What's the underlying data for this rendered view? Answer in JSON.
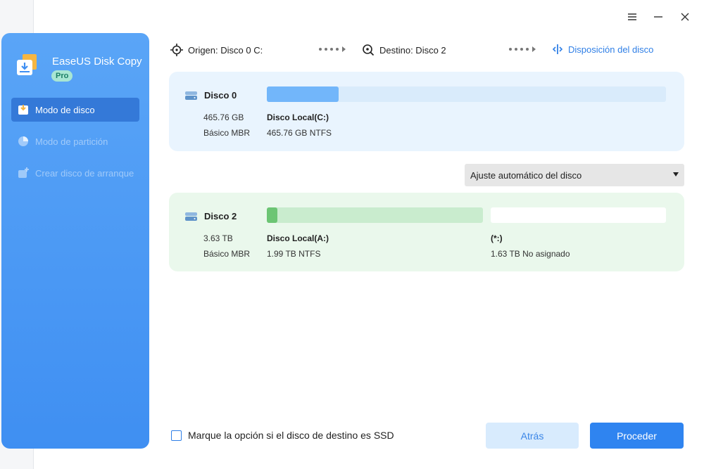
{
  "app": {
    "title": "EaseUS Disk Copy",
    "badge": "Pro"
  },
  "sidebar": {
    "items": [
      {
        "label": "Modo de disco",
        "active": true
      },
      {
        "label": "Modo de partición",
        "active": false
      },
      {
        "label": "Crear disco de arranque",
        "active": false
      }
    ]
  },
  "steps": {
    "source": "Origen: Disco 0 C:",
    "destination": "Destino: Disco 2",
    "layout": "Disposición del disco"
  },
  "source_disk": {
    "name": "Disco 0",
    "size": "465.76 GB",
    "type": "Básico MBR",
    "partition_name": "Disco Local(C:)",
    "partition_detail": "465.76 GB NTFS",
    "used_fraction": 0.18
  },
  "layout_select": {
    "value": "Ajuste automático del disco"
  },
  "dest_disk": {
    "name": "Disco 2",
    "size": "3.63 TB",
    "type": "Básico MBR",
    "partition_name": "Disco Local(A:)",
    "partition_detail": "1.99 TB NTFS",
    "partition_used_fraction": 0.05,
    "unallocated_name": "(*:)",
    "unallocated_detail": "1.63 TB No asignado"
  },
  "footer": {
    "ssd_label": "Marque la opción si el disco de destino es SSD",
    "back_label": "Atrás",
    "proceed_label": "Proceder"
  },
  "colors": {
    "accent": "#2f84f0",
    "sidebar": "#4a98f4",
    "source_bar": "#72b6fa",
    "dest_bar_track": "#c9ecce",
    "dest_bar_fill": "#6cc574"
  }
}
